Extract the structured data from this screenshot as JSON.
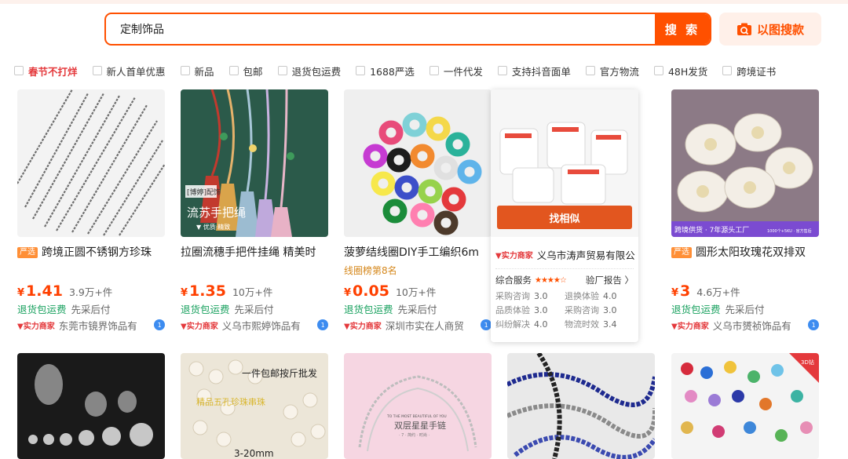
{
  "search": {
    "value": "定制饰品",
    "button_label": "搜 索",
    "image_search_label": "以图搜款"
  },
  "filters": [
    {
      "label": "春节不打烊",
      "highlight": true
    },
    {
      "label": "新人首单优惠"
    },
    {
      "label": "新品"
    },
    {
      "label": "包邮"
    },
    {
      "label": "退货包运费"
    },
    {
      "label": "1688严选"
    },
    {
      "label": "一件代发"
    },
    {
      "label": "支持抖音面单"
    },
    {
      "label": "官方物流"
    },
    {
      "label": "48H发货"
    },
    {
      "label": "跨境证书"
    }
  ],
  "products": [
    {
      "tag": "严选",
      "title": "跨境正圆不锈钢方珍珠",
      "rank": "",
      "yen": "¥",
      "price": "1.41",
      "sold": "3.9万+件",
      "svc1": "退货包运费",
      "svc2": "先采后付",
      "badge": "实力商家",
      "shop": "东莞市镜界饰品有"
    },
    {
      "tag": "",
      "title": "拉圈流穗手把件挂绳 精美时",
      "rank": "",
      "yen": "¥",
      "price": "1.35",
      "sold": "10万+件",
      "svc1": "退货包运费",
      "svc2": "先采后付",
      "badge": "实力商家",
      "shop": "义乌市熙婷饰品有"
    },
    {
      "tag": "",
      "title": "菠萝结线圈DIY手工编织6m",
      "rank": "线圈榜第8名",
      "yen": "¥",
      "price": "0.05",
      "sold": "10万+件",
      "svc1": "退货包运费",
      "svc2": "先采后付",
      "badge": "实力商家",
      "shop": "深圳市实在人商贸"
    },
    {
      "tag": "严选",
      "title": "圆形太阳玫瑰花双排双",
      "rank": "",
      "yen": "¥",
      "price": "3",
      "sold": "4.6万+件",
      "svc1": "退货包运费",
      "svc2": "先采后付",
      "badge": "实力商家",
      "shop": "义乌市赟祯饰品有"
    }
  ],
  "hover_card": {
    "similar_label": "找相似",
    "badge": "实力商家",
    "shop": "义乌市涛声贸易有限公",
    "service_label": "综合服务",
    "stars": "★★★★☆",
    "report_label": "验厂报告 〉",
    "metrics": [
      {
        "label": "采购咨询",
        "value": "3.0"
      },
      {
        "label": "退换体验",
        "value": "4.0"
      },
      {
        "label": "品质体验",
        "value": "3.0"
      },
      {
        "label": "采购咨询",
        "value": "3.0"
      },
      {
        "label": "纠纷解决",
        "value": "4.0"
      },
      {
        "label": "物流时效",
        "value": "3.4"
      }
    ]
  },
  "image_text": {
    "p2_tag": "[博婷]配饰",
    "p2_caption": "流苏手把绳",
    "p2_sub": "▼ 优质·精致",
    "p4_banner": "跨境供货 · 7年源头工厂",
    "p4_spec": "1000个+5KU · 官方售后",
    "r2_p2_top": "一件包邮按斤批发",
    "r2_p2_mid": "精品五孔珍珠串珠",
    "r2_p2_bottom": "3-20mm",
    "r2_p3_top": "TO THE MOST BEAUTIFUL OF YOU",
    "r2_p3_title": "双层星星手链",
    "r2_p3_sub": "· 7 · 简约 · 时尚 ·",
    "r2_p5_badge": "3D钻"
  }
}
